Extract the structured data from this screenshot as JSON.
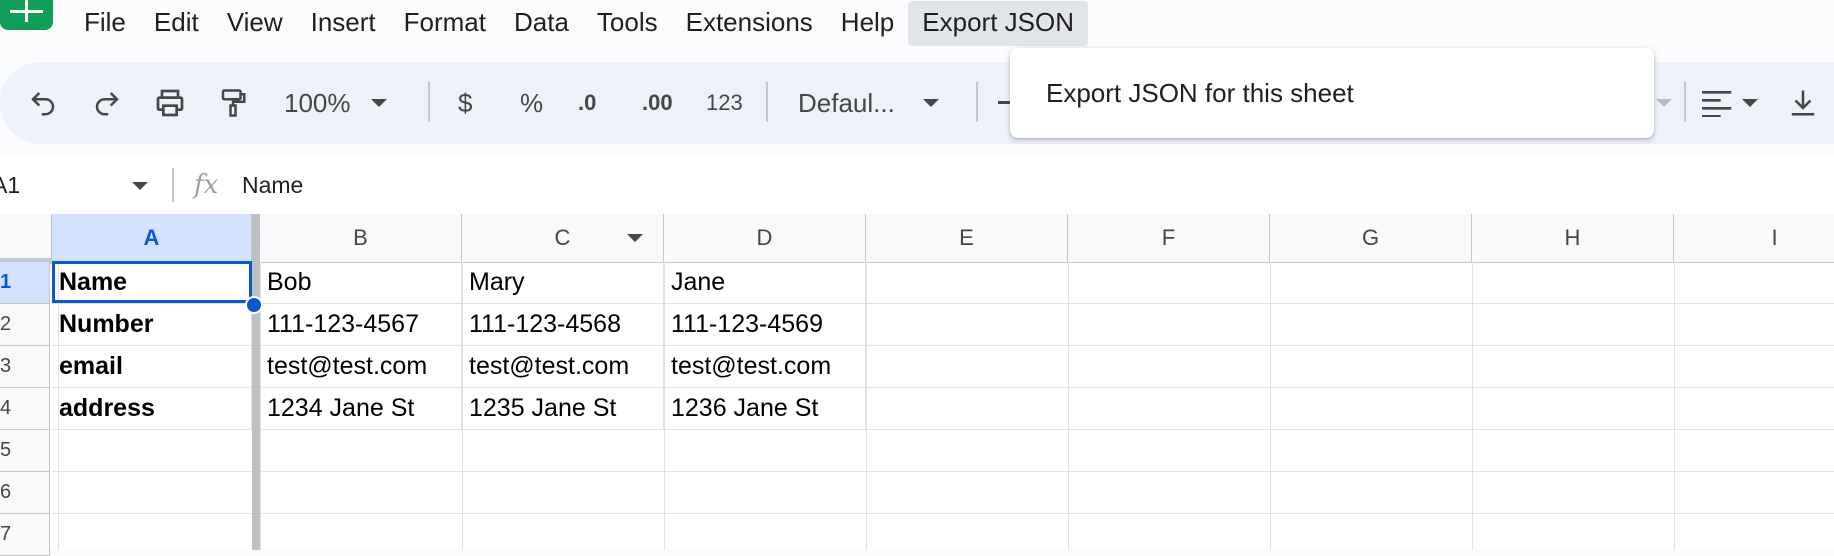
{
  "menu": {
    "items": [
      "File",
      "Edit",
      "View",
      "Insert",
      "Format",
      "Data",
      "Tools",
      "Extensions",
      "Help",
      "Export JSON"
    ],
    "active_item": "Export JSON",
    "dropdown_item": "Export JSON for this sheet"
  },
  "toolbar": {
    "zoom": "100%",
    "currency": "$",
    "percent": "%",
    "decrease_decimal": ".0",
    "increase_decimal": ".00",
    "more_formats": "123",
    "font": "Defaul..."
  },
  "formula_bar": {
    "name_box": "A1",
    "fx_label": "fx",
    "content": "Name"
  },
  "grid": {
    "columns": [
      "A",
      "B",
      "C",
      "D",
      "E",
      "F",
      "G",
      "H",
      "I"
    ],
    "selected_column": "A",
    "row_numbers": [
      "1",
      "2",
      "3",
      "4",
      "5",
      "6",
      "7"
    ],
    "rows": [
      [
        "Name",
        "Bob",
        "Mary",
        "Jane"
      ],
      [
        "Number",
        "111-123-4567",
        "111-123-4568",
        "111-123-4569"
      ],
      [
        "email",
        "test@test.com",
        "test@test.com",
        "test@test.com"
      ],
      [
        "address",
        "1234 Jane St",
        "1235 Jane St",
        "1236 Jane St"
      ],
      [
        "",
        "",
        "",
        ""
      ],
      [
        "",
        "",
        "",
        ""
      ],
      [
        "",
        "",
        "",
        ""
      ]
    ],
    "selected_cell": "A1"
  },
  "colors": {
    "accent": "#0b57d0",
    "selection_fill": "#d3e3fd",
    "toolbar_bg": "#edf2fa",
    "logo_green": "#0f9d58"
  }
}
